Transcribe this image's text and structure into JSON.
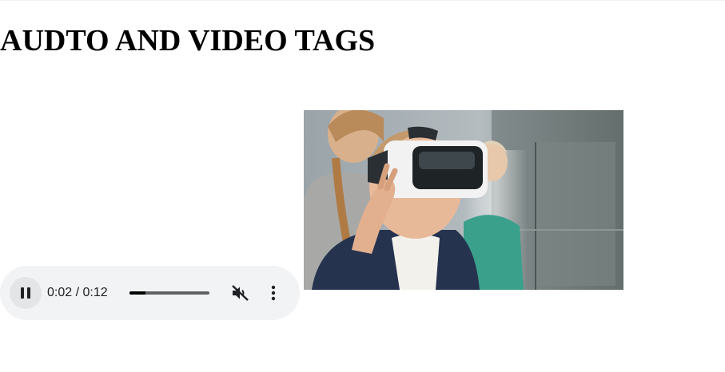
{
  "heading": "AUDTO AND VIDEO TAGS",
  "audio_player": {
    "state": "playing",
    "current_time": "0:02",
    "duration": "0:12",
    "time_display": "0:02 / 0:12",
    "progress_fraction": 0.2,
    "muted": true,
    "icons": {
      "play_pause": "pause-icon",
      "volume": "volume-muted-icon",
      "menu": "more-vertical-icon"
    }
  },
  "video": {
    "icon": "video-frame"
  },
  "colors": {
    "player_bg": "#f1f3f4",
    "player_fg": "#202124"
  }
}
